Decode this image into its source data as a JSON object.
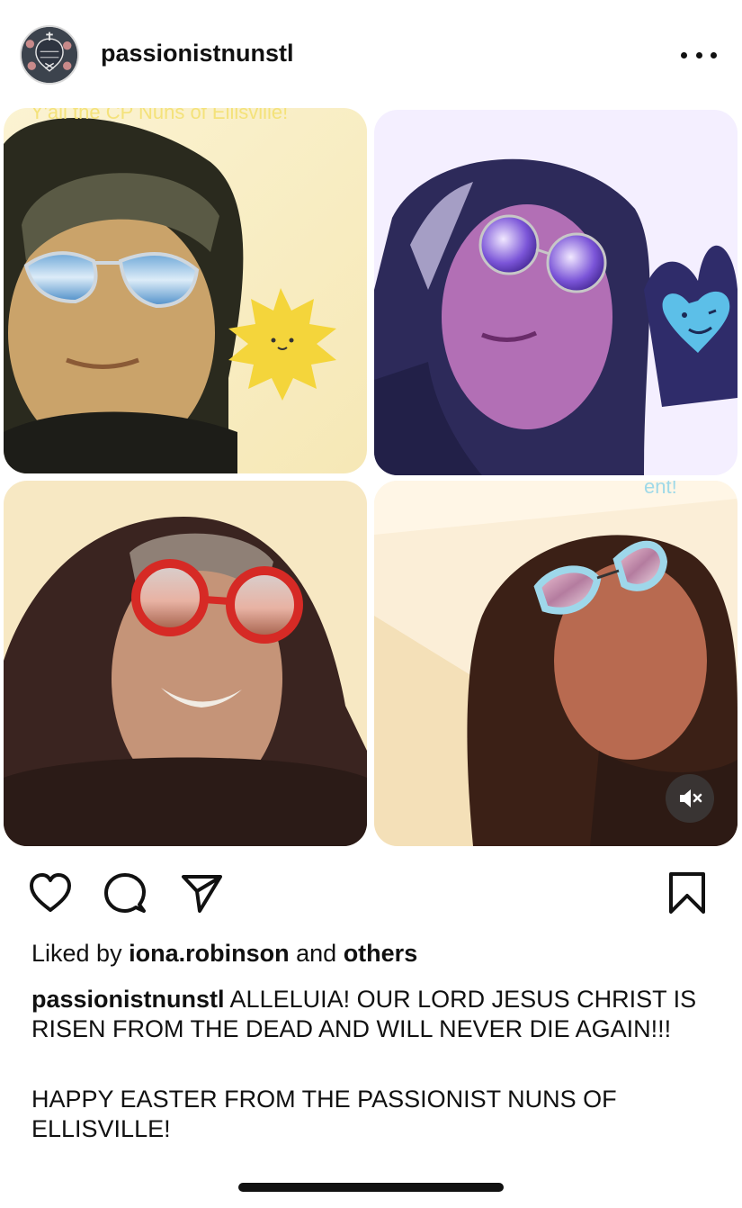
{
  "post": {
    "username": "passionistnunstl",
    "avatar_icon": "passionist-emblem-icon",
    "more_icon": "more-options-icon"
  },
  "media": {
    "overlay_top": "Y'all the CP Nuns of Ellisville!",
    "overlay_bottom": "ent!",
    "mute_icon": "speaker-muted-icon"
  },
  "actions": {
    "like_icon": "heart-icon",
    "comment_icon": "comment-icon",
    "share_icon": "send-icon",
    "save_icon": "bookmark-icon"
  },
  "likes": {
    "prefix": "Liked by",
    "user": "iona.robinson",
    "and": "and",
    "others": "others"
  },
  "caption": {
    "username": "passionistnunstl",
    "line1": "ALLELUIA!  OUR LORD JESUS CHRIST IS RISEN FROM THE DEAD AND WILL NEVER DIE AGAIN!!!",
    "line2": "HAPPY EASTER FROM THE PASSIONIST NUNS OF ELLISVILLE!"
  },
  "colors": {
    "text": "#111111",
    "divider": "#e6e6e6",
    "background": "#ffffff"
  }
}
